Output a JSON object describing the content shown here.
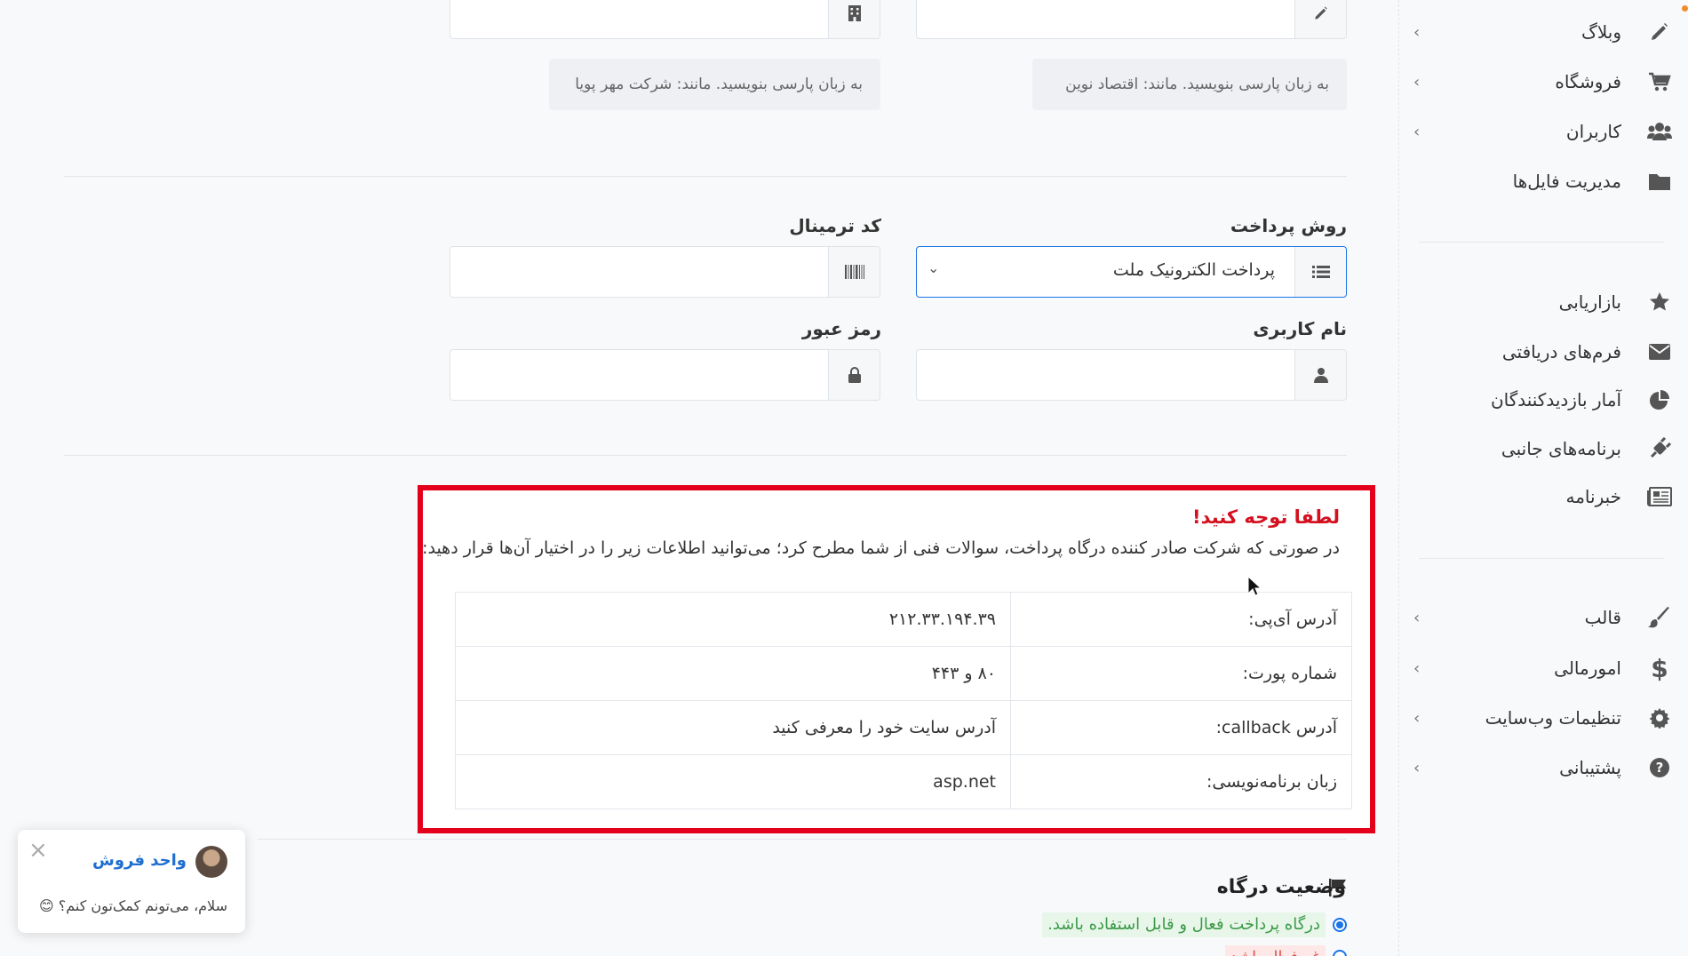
{
  "sidebar": {
    "items": [
      {
        "label": "وبلاگ",
        "icon": "pencil-icon",
        "has_chevron": true
      },
      {
        "label": "فروشگاه",
        "icon": "cart-icon",
        "has_chevron": true
      },
      {
        "label": "کاربران",
        "icon": "users-icon",
        "has_chevron": true
      },
      {
        "label": "مدیریت فایل‌ها",
        "icon": "folder-icon",
        "has_chevron": false
      },
      {
        "label": "بازاریابی",
        "icon": "star-icon",
        "has_chevron": false
      },
      {
        "label": "فرم‌های دریافتی",
        "icon": "envelope-icon",
        "has_chevron": false
      },
      {
        "label": "آمار بازدیدکنندگان",
        "icon": "pie-chart-icon",
        "has_chevron": false
      },
      {
        "label": "برنامه‌های جانبی",
        "icon": "plug-icon",
        "has_chevron": false
      },
      {
        "label": "خبرنامه",
        "icon": "newspaper-icon",
        "has_chevron": false
      },
      {
        "label": "قالب",
        "icon": "brush-icon",
        "has_chevron": true
      },
      {
        "label": "امورمالی",
        "icon": "dollar-icon",
        "has_chevron": true
      },
      {
        "label": "تنظیمات وب‌سایت",
        "icon": "gear-icon",
        "has_chevron": true
      },
      {
        "label": "پشتیبانی",
        "icon": "help-icon",
        "has_chevron": true
      }
    ]
  },
  "form": {
    "hint_right": "به زبان پارسی بنویسید. مانند: اقتصاد نوین",
    "hint_left": "به زبان پارسی بنویسید. مانند: شرکت مهر پویا",
    "payment_method_label": "روش پرداخت",
    "payment_method_value": "پرداخت الکترونیک ملت",
    "terminal_label": "کد ترمینال",
    "username_label": "نام کاربری",
    "password_label": "رمز عبور"
  },
  "notice": {
    "title": "لطفا توجه کنید!",
    "description": "در صورتی که شرکت صادر کننده درگاه پرداخت، سوالات فنی از شما مطرح کرد؛ می‌توانید اطلاعات زیر را در اختیار آن‌ها قرار دهید:",
    "rows": [
      {
        "key": "آدرس آی‌پی:",
        "value": "۲۱۲.۳۳.۱۹۴.۳۹"
      },
      {
        "key": "شماره پورت:",
        "value": "۸۰ و ۴۴۳"
      },
      {
        "key": "آدرس callback:",
        "value": "آدرس سایت خود را معرفی کنید"
      },
      {
        "key": "زبان برنامه‌نویسی:",
        "value": "asp.net"
      }
    ]
  },
  "gateway_status": {
    "title": "وضعیت درگاه",
    "option_active": "درگاه پرداخت فعال و قابل استفاده باشد.",
    "option_inactive": "غیرفعال باشد"
  },
  "chat": {
    "agent_name": "واحد فروش",
    "message": "سلام، می‌تونم کمک‌تون کنم؟ 😊"
  },
  "colors": {
    "accent": "#1a73e8",
    "notice_border": "#e4001b",
    "notice_title": "#d4101f",
    "active_badge": "#3a9a47"
  }
}
